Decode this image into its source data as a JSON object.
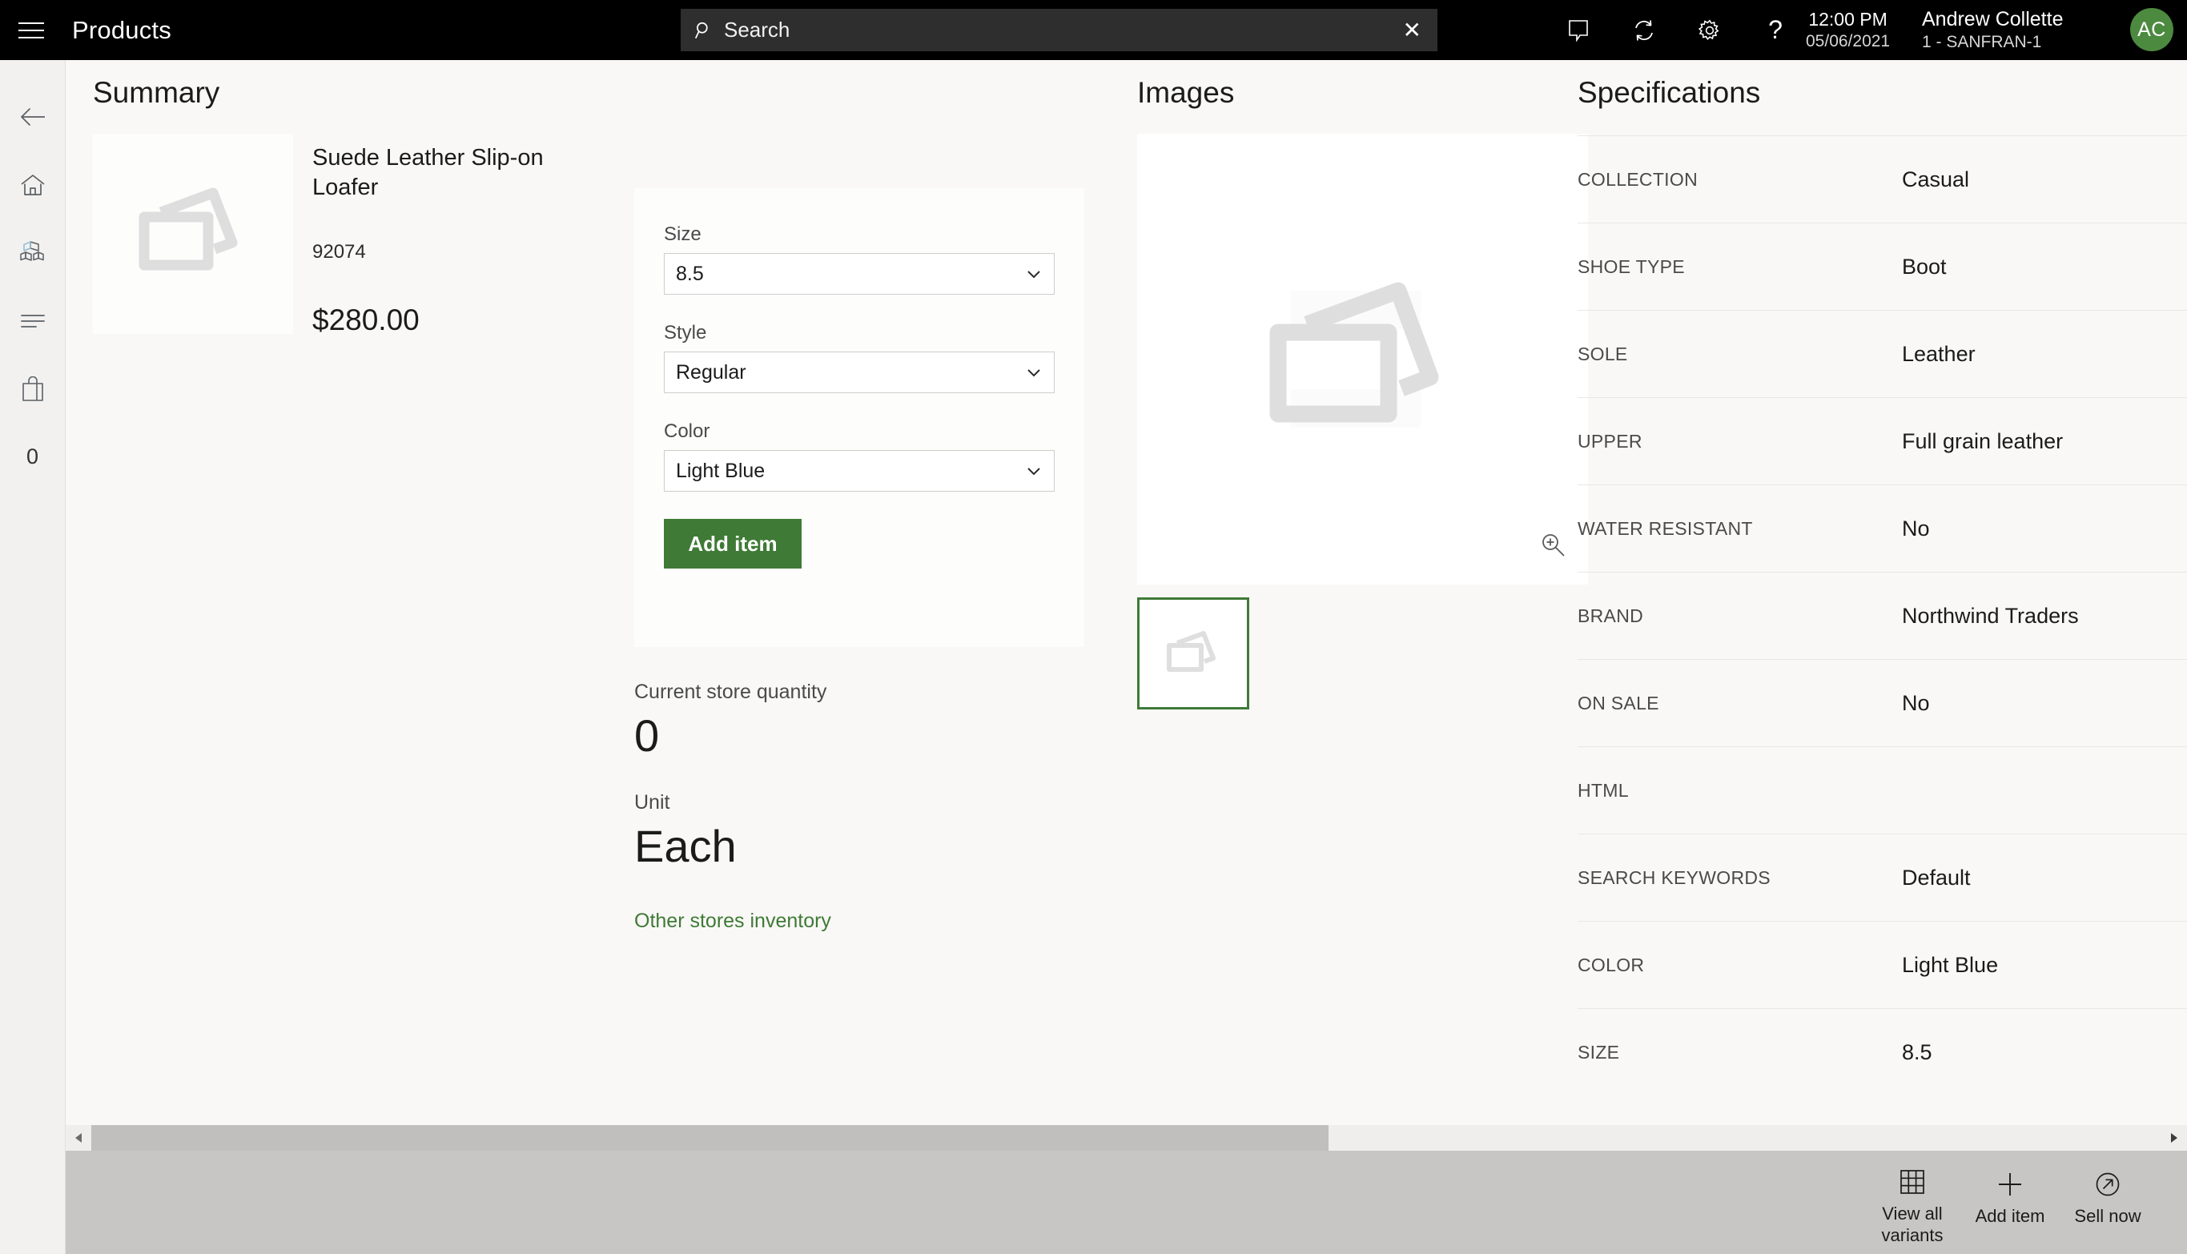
{
  "topbar": {
    "menu_icon": "hamburger-icon",
    "app_title": "Products",
    "search": {
      "icon": "search-icon",
      "placeholder": "Search",
      "value": "Search",
      "clear_icon": "close-icon",
      "clear_glyph": "✕"
    },
    "icons": [
      {
        "name": "feedback-icon",
        "label": "Feedback"
      },
      {
        "name": "sync-icon",
        "label": "Sync"
      },
      {
        "name": "gear-icon",
        "label": "Settings"
      },
      {
        "name": "help-icon",
        "label": "Help",
        "glyph": "?"
      }
    ],
    "clock": {
      "time": "12:00 PM",
      "date": "05/06/2021"
    },
    "user": {
      "name": "Andrew Collette",
      "store": "1 - SANFRAN-1",
      "initials": "AC"
    }
  },
  "rail": {
    "items": [
      {
        "name": "back-icon",
        "label": "Back"
      },
      {
        "name": "home-icon",
        "label": "Home"
      },
      {
        "name": "products-icon",
        "label": "Products"
      },
      {
        "name": "list-icon",
        "label": "Transactions"
      },
      {
        "name": "cart-icon",
        "label": "Cart"
      }
    ],
    "cart_count": "0"
  },
  "summary": {
    "title": "Summary",
    "product": {
      "name": "Suede Leather Slip-on Loafer",
      "sku": "92074",
      "price": "$280.00",
      "image_placeholder_icon": "image-placeholder-icon"
    }
  },
  "variant_form": {
    "fields": [
      {
        "label": "Size",
        "value": "8.5",
        "name": "size-select"
      },
      {
        "label": "Style",
        "value": "Regular",
        "name": "style-select"
      },
      {
        "label": "Color",
        "value": "Light Blue",
        "name": "color-select"
      }
    ],
    "add_item_label": "Add item"
  },
  "inventory": {
    "quantity_label": "Current store quantity",
    "quantity_value": "0",
    "unit_label": "Unit",
    "unit_value": "Each",
    "other_stores_link": "Other stores inventory"
  },
  "images": {
    "title": "Images",
    "zoom_icon": "zoom-in-icon",
    "thumbs": [
      {
        "name": "image-thumbnail",
        "selected": true
      }
    ]
  },
  "specifications": {
    "title": "Specifications",
    "rows": [
      {
        "key": "COLLECTION",
        "value": "Casual"
      },
      {
        "key": "SHOE TYPE",
        "value": "Boot"
      },
      {
        "key": "SOLE",
        "value": "Leather"
      },
      {
        "key": "UPPER",
        "value": "Full grain leather"
      },
      {
        "key": "WATER RESISTANT",
        "value": "No"
      },
      {
        "key": "BRAND",
        "value": "Northwind Traders"
      },
      {
        "key": "ON SALE",
        "value": "No"
      },
      {
        "key": "HTML",
        "value": ""
      },
      {
        "key": "SEARCH KEYWORDS",
        "value": "Default"
      },
      {
        "key": "COLOR",
        "value": "Light Blue"
      },
      {
        "key": "SIZE",
        "value": "8.5"
      }
    ]
  },
  "scrollbar": {
    "left_arrow_glyph": "◀",
    "right_arrow_glyph": "▶"
  },
  "bottombar": {
    "buttons": [
      {
        "label": "View all variants",
        "icon": "grid-icon",
        "name": "view-all-variants-button"
      },
      {
        "label": "Add item",
        "icon": "plus-icon",
        "name": "add-item-bottom-button"
      },
      {
        "label": "Sell now",
        "icon": "arrow-circle-icon",
        "name": "sell-now-button"
      }
    ]
  },
  "colors": {
    "accent_green": "#3F7A36",
    "avatar_green": "#4C8A3F",
    "topbar_black": "#000000",
    "page_bg": "#F9F8F6",
    "rail_bg": "#F2F1EF",
    "bottombar_bg": "#C8C6C4",
    "card_bg": "#FDFDFC"
  }
}
